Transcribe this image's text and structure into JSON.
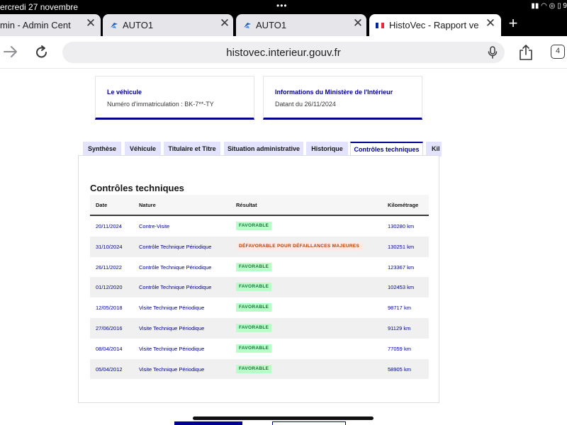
{
  "statusbar": {
    "date": "ercredi 27 novembre",
    "dots": "•••",
    "right": "▮▮ ◠ ◎ ▯ 9"
  },
  "browser": {
    "tabs": [
      {
        "title": "min - Admin Center",
        "close": "✕",
        "favicon": ""
      },
      {
        "title": "AUTO1",
        "close": "✕",
        "favicon": "auto1-logo-icon"
      },
      {
        "title": "AUTO1",
        "close": "✕",
        "favicon": "auto1-logo-icon"
      },
      {
        "title": "HistoVec - Rapport vendu",
        "close": "✕",
        "favicon": "french-flag-icon"
      }
    ],
    "new_tab": "+",
    "url": "histovec.interieur.gouv.fr",
    "tab_count": "4",
    "icons": [
      "forward-arrow-icon",
      "reload-icon",
      "microphone-icon",
      "share-icon",
      "tabs-icon"
    ]
  },
  "cards": {
    "vehicle": {
      "title": "Le véhicule",
      "text": "Numéro d'immatriculation : BK-7**-TY"
    },
    "ministry": {
      "title": "Informations du Ministère de l'Intérieur",
      "text": "Datant du 26/11/2024"
    }
  },
  "page_tabs": [
    {
      "label": "Synthèse",
      "active": false
    },
    {
      "label": "Véhicule",
      "active": false
    },
    {
      "label": "Titulaire et Titre",
      "active": false
    },
    {
      "label": "Situation administrative",
      "active": false
    },
    {
      "label": "Historique",
      "active": false
    },
    {
      "label": "Contrôles techniques",
      "active": true
    },
    {
      "label": "Kil",
      "active": false
    }
  ],
  "controls": {
    "title": "Contrôles techniques",
    "headers": {
      "date": "Date",
      "nature": "Nature",
      "result": "Résultat",
      "km": "Kilométrage"
    },
    "rows": [
      {
        "date": "20/11/2024",
        "nature": "Contre-Visite",
        "result": "FAVORABLE",
        "status": "ok",
        "km": "130280 km"
      },
      {
        "date": "31/10/2024",
        "nature": "Contrôle Technique Périodique",
        "result": "DÉFAVORABLE POUR DÉFAILLANCES MAJEURES",
        "status": "ko",
        "km": "130251 km"
      },
      {
        "date": "26/11/2022",
        "nature": "Contrôle Technique Périodique",
        "result": "FAVORABLE",
        "status": "ok",
        "km": "123367 km"
      },
      {
        "date": "01/12/2020",
        "nature": "Contrôle Technique Périodique",
        "result": "FAVORABLE",
        "status": "ok",
        "km": "102453 km"
      },
      {
        "date": "12/05/2018",
        "nature": "Visite Technique Périodique",
        "result": "FAVORABLE",
        "status": "ok",
        "km": "98717 km"
      },
      {
        "date": "27/06/2016",
        "nature": "Visite Technique Périodique",
        "result": "FAVORABLE",
        "status": "ok",
        "km": "91129 km"
      },
      {
        "date": "08/04/2014",
        "nature": "Visite Technique Périodique",
        "result": "FAVORABLE",
        "status": "ok",
        "km": "77059 km"
      },
      {
        "date": "05/04/2012",
        "nature": "Visite Technique Périodique",
        "result": "FAVORABLE",
        "status": "ok",
        "km": "58905 km"
      }
    ]
  },
  "colors": {
    "brand_blue": "#000091",
    "ok_bg": "#b8fec9",
    "ok_fg": "#18753c",
    "ko_bg": "#ffe9e6",
    "ko_fg": "#b34000"
  }
}
